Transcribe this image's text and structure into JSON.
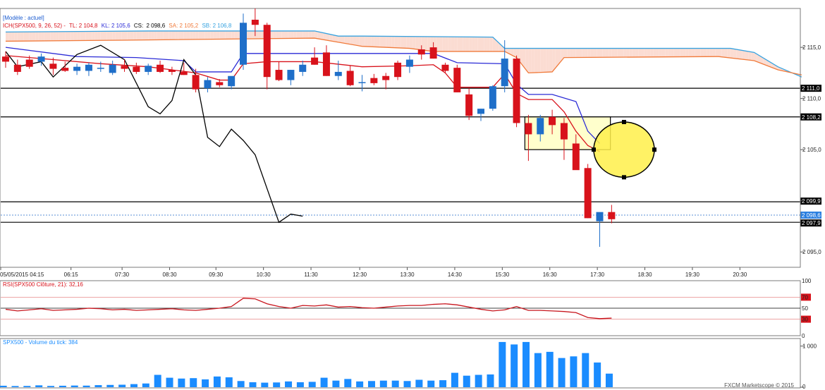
{
  "legend": {
    "model": "[Modèle : actuel]",
    "ich_prefix": "ICH(SPX500, 9, 26, 52) -",
    "tl": "TL: 2 104,8",
    "kl": "KL: 2 105,6",
    "cs_label": "CS:",
    "cs_value": "2 098,6",
    "sa": "SA: 2 105,2",
    "sb": "SB: 2 106,8"
  },
  "rsi_label": "RSI(SPX500 Clôture, 21): 32,16",
  "volume_label": "SPX500 - Volume du tick: 384",
  "watermark": "FXCM Marketscope © 2015",
  "colors": {
    "up": "#1f6fc9",
    "down": "#d8121b",
    "tenkan": "#d8121b",
    "kijun": "#2b2bd6",
    "chikou": "#000000",
    "senkou_a": "#f07a3a",
    "senkou_b": "#36a2e0",
    "cloud_bull": "#cfe9f7",
    "cloud_bear": "#fbdcd2",
    "rsi": "#c8161e",
    "volume": "#1a8cff"
  },
  "chart_data": {
    "type": "candlestick",
    "time_labels": [
      "05/05/2015 04:15",
      "06:15",
      "07:30",
      "08:30",
      "09:30",
      "10:30",
      "11:30",
      "12:30",
      "13:30",
      "14:30",
      "15:30",
      "16:30",
      "17:30",
      "18:30",
      "19:30",
      "20:30"
    ],
    "ylim": [
      2093.5,
      2118.8
    ],
    "yticks": [
      "2 095,0",
      "2 100,0",
      "2 105,0",
      "2 110,0",
      "2 115,0"
    ],
    "candles": [
      {
        "o": 2114.1,
        "h": 2114.6,
        "l": 2113.0,
        "c": 2113.6
      },
      {
        "o": 2113.3,
        "h": 2113.8,
        "l": 2112.3,
        "c": 2112.6
      },
      {
        "o": 2113.8,
        "h": 2114.2,
        "l": 2112.9,
        "c": 2113.1
      },
      {
        "o": 2113.6,
        "h": 2114.4,
        "l": 2113.2,
        "c": 2114.1
      },
      {
        "o": 2113.4,
        "h": 2114.0,
        "l": 2112.3,
        "c": 2112.9
      },
      {
        "o": 2113.0,
        "h": 2113.6,
        "l": 2112.6,
        "c": 2112.7
      },
      {
        "o": 2112.7,
        "h": 2113.4,
        "l": 2112.3,
        "c": 2113.1
      },
      {
        "o": 2112.7,
        "h": 2113.5,
        "l": 2112.2,
        "c": 2113.3
      },
      {
        "o": 2113.0,
        "h": 2113.6,
        "l": 2112.6,
        "c": 2113.0
      },
      {
        "o": 2112.5,
        "h": 2113.7,
        "l": 2112.3,
        "c": 2113.3
      },
      {
        "o": 2113.2,
        "h": 2113.8,
        "l": 2112.6,
        "c": 2112.9
      },
      {
        "o": 2113.1,
        "h": 2113.5,
        "l": 2112.4,
        "c": 2112.6
      },
      {
        "o": 2112.6,
        "h": 2113.4,
        "l": 2112.3,
        "c": 2113.2
      },
      {
        "o": 2113.3,
        "h": 2113.7,
        "l": 2112.5,
        "c": 2112.6
      },
      {
        "o": 2112.8,
        "h": 2113.1,
        "l": 2112.3,
        "c": 2112.6
      },
      {
        "o": 2112.6,
        "h": 2113.5,
        "l": 2112.3,
        "c": 2112.3
      },
      {
        "o": 2112.3,
        "h": 2112.9,
        "l": 2110.6,
        "c": 2110.9
      },
      {
        "o": 2111.0,
        "h": 2112.1,
        "l": 2110.6,
        "c": 2111.8
      },
      {
        "o": 2111.6,
        "h": 2111.9,
        "l": 2111.1,
        "c": 2111.3
      },
      {
        "o": 2111.2,
        "h": 2112.1,
        "l": 2110.9,
        "c": 2112.2
      },
      {
        "o": 2113.3,
        "h": 2118.3,
        "l": 2112.8,
        "c": 2117.4
      },
      {
        "o": 2117.7,
        "h": 2118.8,
        "l": 2116.1,
        "c": 2117.2
      },
      {
        "o": 2117.2,
        "h": 2117.4,
        "l": 2110.9,
        "c": 2112.1
      },
      {
        "o": 2112.8,
        "h": 2113.6,
        "l": 2111.7,
        "c": 2111.8
      },
      {
        "o": 2111.8,
        "h": 2112.8,
        "l": 2111.3,
        "c": 2112.8
      },
      {
        "o": 2112.6,
        "h": 2113.7,
        "l": 2112.2,
        "c": 2113.3
      },
      {
        "o": 2114.0,
        "h": 2115.0,
        "l": 2113.3,
        "c": 2113.3
      },
      {
        "o": 2114.5,
        "h": 2115.2,
        "l": 2112.2,
        "c": 2112.2
      },
      {
        "o": 2112.2,
        "h": 2113.7,
        "l": 2111.8,
        "c": 2112.6
      },
      {
        "o": 2112.7,
        "h": 2113.2,
        "l": 2111.2,
        "c": 2111.3
      },
      {
        "o": 2111.6,
        "h": 2112.3,
        "l": 2110.7,
        "c": 2111.6
      },
      {
        "o": 2112.0,
        "h": 2112.4,
        "l": 2111.3,
        "c": 2111.5
      },
      {
        "o": 2112.2,
        "h": 2112.5,
        "l": 2110.9,
        "c": 2111.8
      },
      {
        "o": 2113.5,
        "h": 2113.7,
        "l": 2111.8,
        "c": 2112.1
      },
      {
        "o": 2113.1,
        "h": 2114.2,
        "l": 2112.5,
        "c": 2113.8
      },
      {
        "o": 2114.8,
        "h": 2115.2,
        "l": 2113.8,
        "c": 2114.3
      },
      {
        "o": 2115.0,
        "h": 2115.5,
        "l": 2113.9,
        "c": 2113.9
      },
      {
        "o": 2113.3,
        "h": 2113.5,
        "l": 2112.5,
        "c": 2112.7
      },
      {
        "o": 2113.0,
        "h": 2113.3,
        "l": 2110.6,
        "c": 2110.6
      },
      {
        "o": 2110.4,
        "h": 2111.0,
        "l": 2107.9,
        "c": 2108.3
      },
      {
        "o": 2108.5,
        "h": 2109.0,
        "l": 2107.8,
        "c": 2109.0
      },
      {
        "o": 2109.0,
        "h": 2111.3,
        "l": 2108.8,
        "c": 2111.2
      },
      {
        "o": 2111.2,
        "h": 2115.7,
        "l": 2110.6,
        "c": 2113.9
      },
      {
        "o": 2113.9,
        "h": 2114.2,
        "l": 2107.2,
        "c": 2107.6
      },
      {
        "o": 2107.6,
        "h": 2108.4,
        "l": 2103.9,
        "c": 2106.5
      },
      {
        "o": 2106.5,
        "h": 2108.4,
        "l": 2105.8,
        "c": 2108.1
      },
      {
        "o": 2108.2,
        "h": 2108.9,
        "l": 2106.5,
        "c": 2107.4
      },
      {
        "o": 2107.6,
        "h": 2108.1,
        "l": 2104.0,
        "c": 2106.0
      },
      {
        "o": 2105.6,
        "h": 2106.5,
        "l": 2104.7,
        "c": 2103.0
      },
      {
        "o": 2103.2,
        "h": 2103.6,
        "l": 2098.3,
        "c": 2098.3
      },
      {
        "o": 2098.0,
        "h": 2098.3,
        "l": 2095.5,
        "c": 2098.9
      },
      {
        "o": 2098.9,
        "h": 2099.6,
        "l": 2097.8,
        "c": 2098.2
      }
    ],
    "tenkan": [
      [
        0,
        2114.2
      ],
      [
        4,
        2113.8
      ],
      [
        8,
        2113.4
      ],
      [
        12,
        2113.1
      ],
      [
        16,
        2112.5
      ],
      [
        18,
        2111.8
      ],
      [
        19,
        2111.8
      ],
      [
        20,
        2113.4
      ],
      [
        22,
        2113.6
      ],
      [
        26,
        2113.6
      ],
      [
        30,
        2113.1
      ],
      [
        34,
        2113.2
      ],
      [
        36,
        2113.3
      ],
      [
        37,
        2112.5
      ],
      [
        38,
        2111.1
      ],
      [
        41,
        2111.1
      ],
      [
        42,
        2112.4
      ],
      [
        43,
        2110.5
      ],
      [
        44,
        2109.9
      ],
      [
        46,
        2109.9
      ],
      [
        47,
        2108.7
      ],
      [
        48,
        2106.8
      ],
      [
        49,
        2105.4
      ],
      [
        50,
        2104.8
      ]
    ],
    "kijun": [
      [
        0,
        2115.0
      ],
      [
        6,
        2114.1
      ],
      [
        11,
        2114.0
      ],
      [
        15,
        2113.7
      ],
      [
        16,
        2112.6
      ],
      [
        19,
        2112.6
      ],
      [
        20,
        2114.4
      ],
      [
        30,
        2114.4
      ],
      [
        36,
        2114.4
      ],
      [
        38,
        2113.5
      ],
      [
        42,
        2113.4
      ],
      [
        43,
        2111.4
      ],
      [
        44,
        2110.4
      ],
      [
        46,
        2110.4
      ],
      [
        48,
        2109.7
      ],
      [
        49,
        2106.8
      ],
      [
        50,
        2105.6
      ]
    ],
    "chikou": [
      [
        0,
        2114.6
      ],
      [
        1,
        2113.1
      ],
      [
        3,
        2113.6
      ],
      [
        4,
        2112.1
      ],
      [
        6,
        2114.3
      ],
      [
        8,
        2115.2
      ],
      [
        10,
        2113.8
      ],
      [
        12,
        2109.2
      ],
      [
        13,
        2108.5
      ],
      [
        14,
        2109.8
      ],
      [
        15,
        2113.8
      ],
      [
        16,
        2112.3
      ],
      [
        17,
        2106.2
      ],
      [
        18,
        2105.3
      ],
      [
        19,
        2107.0
      ],
      [
        20,
        2105.9
      ],
      [
        21,
        2104.5
      ],
      [
        22,
        2101.2
      ],
      [
        23,
        2097.9
      ],
      [
        24,
        2098.7
      ],
      [
        25,
        2098.5
      ]
    ],
    "senkou_a": [
      [
        0,
        2115.6
      ],
      [
        10,
        2115.7
      ],
      [
        26,
        2115.9
      ],
      [
        28,
        2115.5
      ],
      [
        30,
        2115.1
      ],
      [
        34,
        2114.9
      ],
      [
        36,
        2114.6
      ],
      [
        42,
        2114.6
      ],
      [
        43,
        2114.0
      ],
      [
        44,
        2112.5
      ],
      [
        46,
        2112.6
      ],
      [
        47,
        2114.0
      ],
      [
        60,
        2114.1
      ],
      [
        63,
        2113.7
      ],
      [
        65,
        2112.8
      ],
      [
        67,
        2112.3
      ]
    ],
    "senkou_b": [
      [
        0,
        2116.5
      ],
      [
        12,
        2116.6
      ],
      [
        26,
        2116.6
      ],
      [
        28,
        2116.1
      ],
      [
        30,
        2116.1
      ],
      [
        41,
        2116.0
      ],
      [
        42,
        2114.9
      ],
      [
        61,
        2114.9
      ],
      [
        63,
        2114.5
      ],
      [
        65,
        2113.1
      ],
      [
        67,
        2112.1
      ]
    ],
    "hlines": [
      {
        "value": 2111.0,
        "label": "2 111,0"
      },
      {
        "value": 2108.2,
        "label": "2 108,2"
      },
      {
        "value": 2099.9,
        "label": "2 099,9"
      },
      {
        "value": 2098.6,
        "label": "2 098,6"
      },
      {
        "value": 2097.9,
        "label": "2 097,9"
      }
    ],
    "rsi": {
      "ticks": [
        "100",
        "70",
        "50",
        "30",
        "0"
      ],
      "values": [
        48,
        45,
        47,
        49,
        46,
        47,
        48,
        50,
        49,
        47,
        48,
        46,
        47,
        48,
        49,
        47,
        46,
        48,
        50,
        53,
        68,
        67,
        58,
        53,
        50,
        55,
        54,
        56,
        52,
        53,
        51,
        50,
        52,
        54,
        55,
        55,
        57,
        58,
        56,
        52,
        48,
        45,
        47,
        53,
        46,
        46,
        45,
        44,
        42,
        33,
        31,
        32
      ]
    },
    "volume": {
      "ticks": [
        "1 000",
        "0"
      ],
      "values": [
        30,
        25,
        40,
        35,
        28,
        30,
        45,
        30,
        35,
        40,
        38,
        50,
        55,
        60,
        75,
        90,
        300,
        230,
        210,
        220,
        190,
        260,
        240,
        150,
        120,
        110,
        115,
        140,
        120,
        130,
        230,
        160,
        200,
        140,
        150,
        160,
        160,
        150,
        180,
        160,
        170,
        350,
        280,
        300,
        310,
        1100,
        1040,
        1100,
        830,
        860,
        710,
        750,
        830,
        600,
        330
      ]
    }
  }
}
